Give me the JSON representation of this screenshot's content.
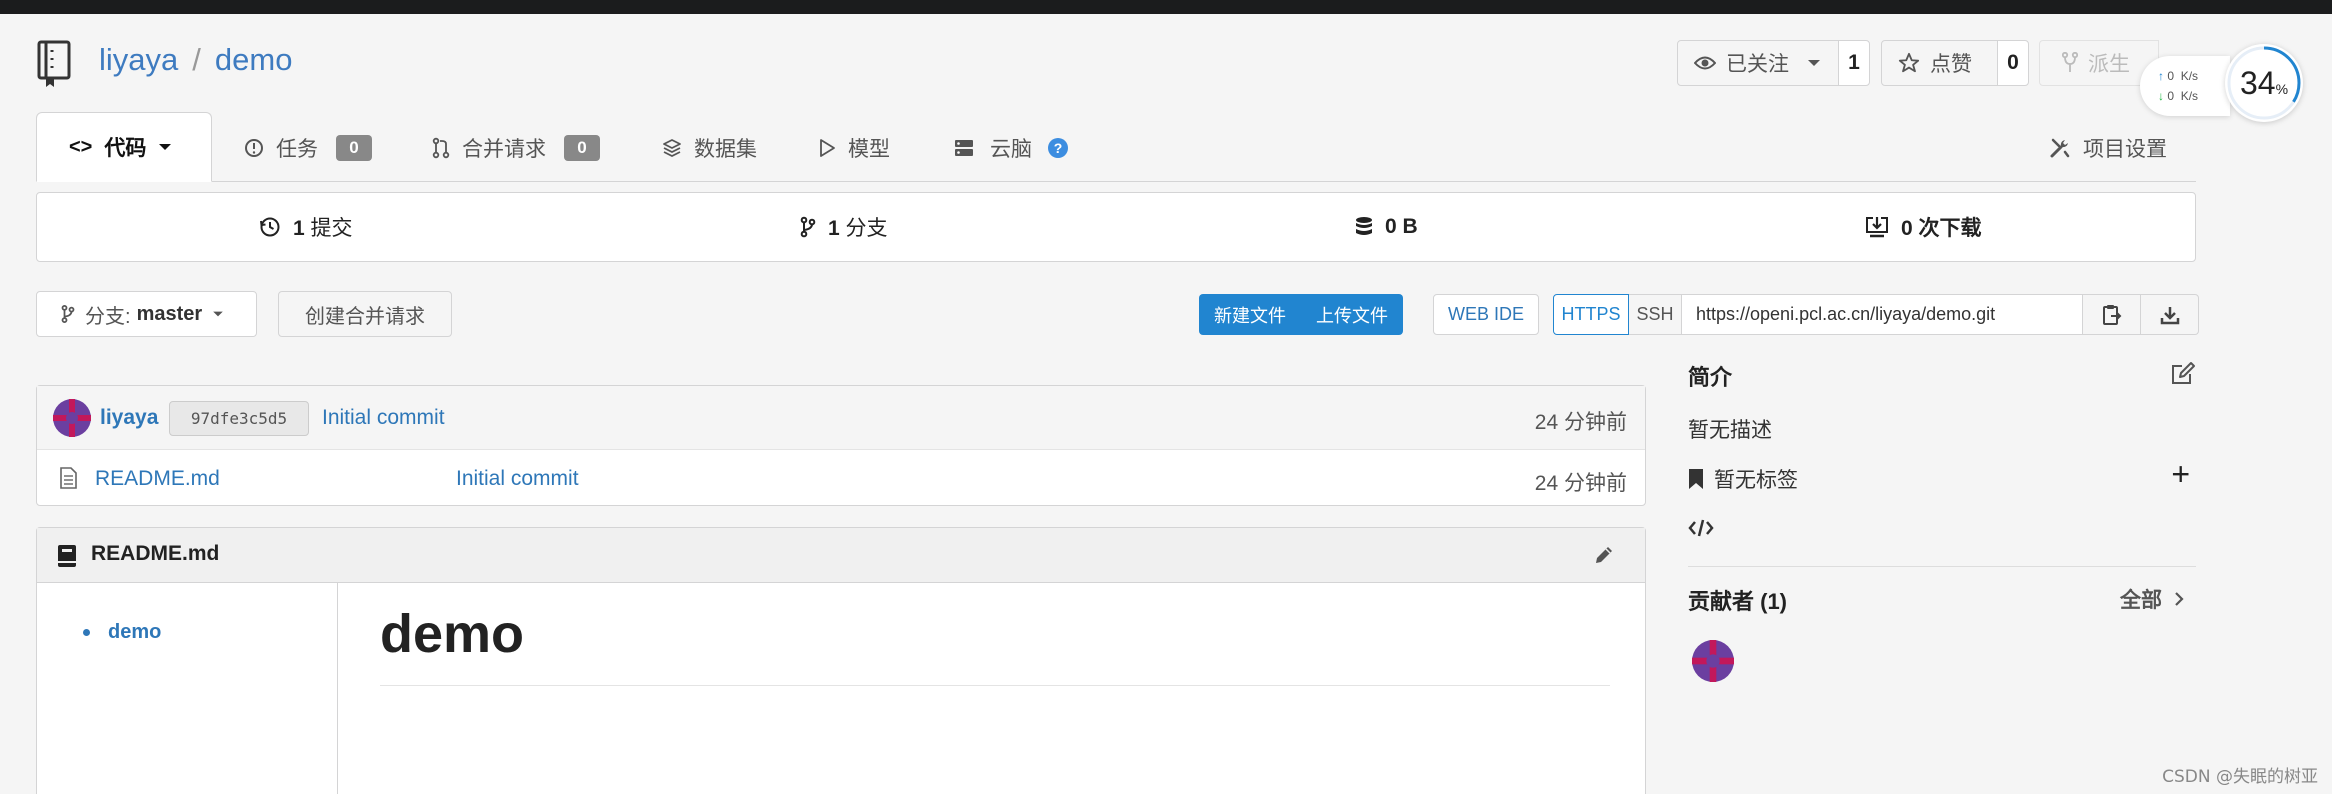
{
  "repo": {
    "owner": "liyaya",
    "separator": "/",
    "name": "demo"
  },
  "header_actions": {
    "watch_label": "已关注",
    "watch_count": "1",
    "star_label": "点赞",
    "star_count": "0",
    "fork_label": "派生"
  },
  "net_speed": {
    "up": "0",
    "down": "0",
    "unit": "K/s",
    "percent": "34",
    "percent_sign": "%",
    "percent_value": 0.34
  },
  "tabs": [
    {
      "label": "代码",
      "icon": "code-icon"
    },
    {
      "label": "任务",
      "badge": "0",
      "icon": "issue-icon"
    },
    {
      "label": "合并请求",
      "badge": "0",
      "icon": "pull-request-icon"
    },
    {
      "label": "数据集",
      "icon": "dataset-layers-icon"
    },
    {
      "label": "模型",
      "icon": "model-play-icon"
    },
    {
      "label": "云脑",
      "icon": "cloudbrain-server-icon",
      "help": "?"
    },
    {
      "label": "项目设置",
      "icon": "settings-tools-icon"
    }
  ],
  "stats": {
    "commits_count": "1",
    "commits_label": "提交",
    "branches_count": "1",
    "branches_label": "分支",
    "size": "0 B",
    "downloads_count": "0",
    "downloads_label": "次下载"
  },
  "toolbar": {
    "branch_prefix": "分支:",
    "branch_name": "master",
    "new_pr": "创建合并请求",
    "new_file": "新建文件",
    "upload_file": "上传文件",
    "web_ide": "WEB IDE",
    "https": "HTTPS",
    "ssh": "SSH",
    "clone_url": "https://openi.pcl.ac.cn/liyaya/demo.git"
  },
  "latest_commit": {
    "user": "liyaya",
    "sha": "97dfe3c5d5",
    "message": "Initial commit",
    "time": "24 分钟前"
  },
  "files": [
    {
      "name": "README.md",
      "commit": "Initial commit",
      "time": "24 分钟前"
    }
  ],
  "readme": {
    "title": "README.md",
    "toc": [
      "demo"
    ],
    "heading": "demo"
  },
  "sidebar": {
    "intro_title": "简介",
    "intro_text": "暂无描述",
    "tags_text": "暂无标签",
    "add_symbol": "+",
    "contributors_title": "贡献者 (1)",
    "contributors_all": "全部"
  },
  "watermark": "CSDN @失眠的树亚",
  "colors": {
    "accent": "#2185d0",
    "link": "#2e77b8",
    "avatar_purple": "#6b3fa0",
    "avatar_pink": "#c2185b"
  }
}
